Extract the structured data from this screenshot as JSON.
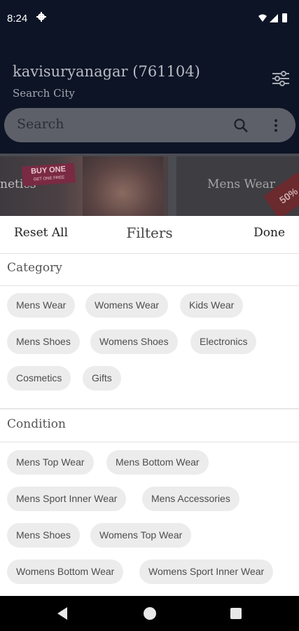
{
  "status_bar": {
    "time": "8:24"
  },
  "header": {
    "location": "kavisuryanagar (761104)",
    "subtitle": "Search City",
    "search_placeholder": "Search"
  },
  "banners": [
    {
      "label": "netics",
      "offer_line1": "BUY ONE",
      "offer_line2": "GET ONE FREE"
    },
    {
      "label": "Mens Wear",
      "tag": "50%"
    }
  ],
  "sheet": {
    "reset_label": "Reset All",
    "title": "Filters",
    "done_label": "Done"
  },
  "category": {
    "title": "Category",
    "chips": [
      "Mens Wear",
      "Womens Wear",
      "Kids Wear",
      "Mens Shoes",
      "Womens Shoes",
      "Electronics",
      "Cosmetics",
      "Gifts"
    ]
  },
  "condition": {
    "title": "Condition",
    "chips": [
      "Mens Top Wear",
      "Mens Bottom Wear",
      "Mens Sport Inner Wear",
      "Mens Accessories",
      "Mens Shoes",
      "Womens Top Wear",
      "Womens Bottom Wear",
      "Womens Sport Inner Wear"
    ]
  },
  "colors": {
    "app_bg": "#0d1426",
    "chip_bg": "#ececec",
    "chip_text": "#4d4d4d"
  }
}
